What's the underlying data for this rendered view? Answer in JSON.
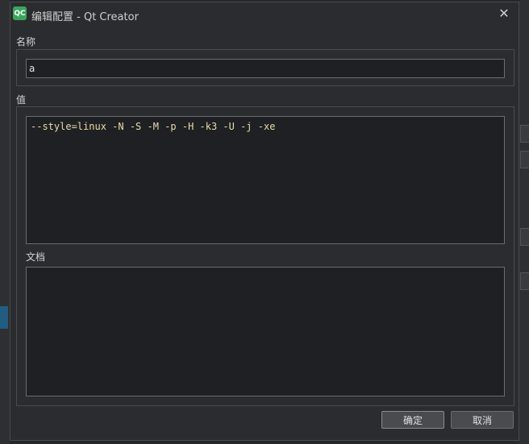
{
  "dialog": {
    "title": "编辑配置 - Qt Creator",
    "app_icon_text": "QC",
    "close_glyph": "✕"
  },
  "form": {
    "name_label": "名称",
    "name_value": "a",
    "value_label": "值",
    "value_text": "--style=linux -N -S -M -p -H -k3 -U -j -xe",
    "doc_label": "文档",
    "doc_text": ""
  },
  "buttons": {
    "ok": "确定",
    "cancel": "取消"
  },
  "colors": {
    "background": "#2b2c2f",
    "input_bg": "#1f2023",
    "code_text": "#e6dba8",
    "icon_green": "#3aa55c"
  }
}
